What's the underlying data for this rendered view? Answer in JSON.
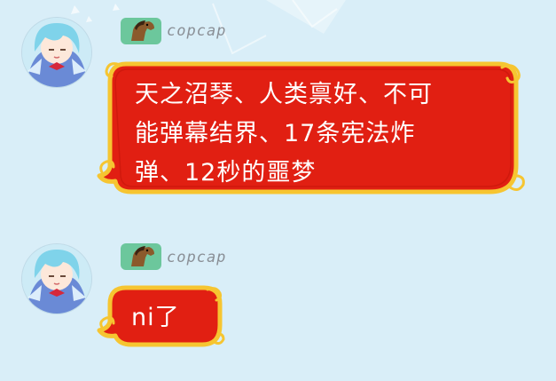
{
  "chat": {
    "messages": [
      {
        "sender": "copcap",
        "avatar_icon": "cirno-avatar-icon",
        "badge_icon": "horse-badge-icon",
        "text": "天之沼琴、人类禀好、不可\n能弹幕结界、17条宪法炸\n弹、12秒的噩梦"
      },
      {
        "sender": "copcap",
        "avatar_icon": "cirno-avatar-icon",
        "badge_icon": "horse-badge-icon",
        "text": "ni了"
      }
    ]
  },
  "colors": {
    "background": "#d9eef8",
    "bubble_fill": "#e11f12",
    "bubble_border": "#f6c531",
    "badge": "#6cc79c",
    "sender_text": "#8a8f96"
  }
}
